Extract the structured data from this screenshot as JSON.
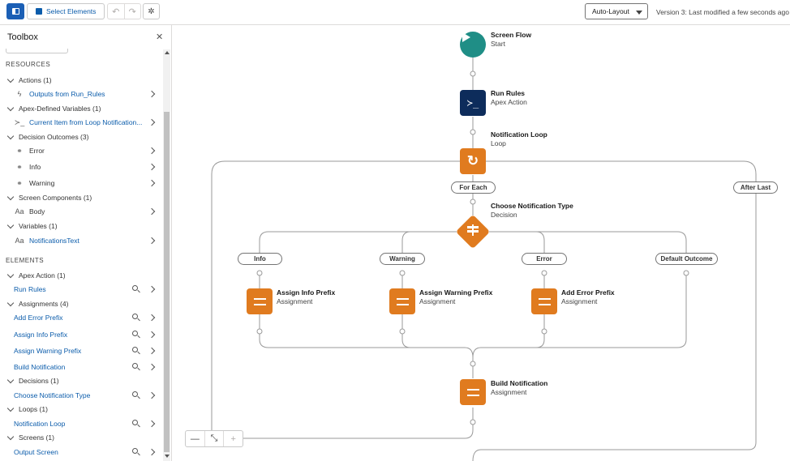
{
  "toolbar": {
    "select_elements": "Select Elements",
    "auto_layout": "Auto-Layout",
    "version_text": "Version 3: Last modified a few seconds ago"
  },
  "toolbox": {
    "title": "Toolbox",
    "resources_heading": "RESOURCES",
    "elements_heading": "ELEMENTS",
    "resources": [
      {
        "group": "Actions (1)",
        "items": [
          {
            "icon": "lightning-icon",
            "label": "Outputs from Run_Rules",
            "link": true
          }
        ]
      },
      {
        "group": "Apex-Defined Variables (1)",
        "items": [
          {
            "icon": "apex-icon",
            "label": "Current Item from Loop Notification...",
            "link": true
          }
        ]
      },
      {
        "group": "Decision Outcomes (3)",
        "items": [
          {
            "icon": "outcome-icon",
            "label": "Error",
            "link": false
          },
          {
            "icon": "outcome-icon",
            "label": "Info",
            "link": false
          },
          {
            "icon": "outcome-icon",
            "label": "Warning",
            "link": false
          }
        ]
      },
      {
        "group": "Screen Components (1)",
        "items": [
          {
            "icon": "text-icon",
            "label": "Body",
            "link": false
          }
        ]
      },
      {
        "group": "Variables (1)",
        "items": [
          {
            "icon": "text-icon",
            "label": "NotificationsText",
            "link": true
          }
        ]
      }
    ],
    "elements": [
      {
        "group": "Apex Action (1)",
        "items": [
          "Run Rules"
        ]
      },
      {
        "group": "Assignments (4)",
        "items": [
          "Add Error Prefix",
          "Assign Info Prefix",
          "Assign Warning Prefix",
          "Build Notification"
        ]
      },
      {
        "group": "Decisions (1)",
        "items": [
          "Choose Notification Type"
        ]
      },
      {
        "group": "Loops (1)",
        "items": [
          "Notification Loop"
        ]
      },
      {
        "group": "Screens (1)",
        "items": [
          "Output Screen"
        ]
      }
    ]
  },
  "canvas": {
    "start": {
      "title": "Screen Flow",
      "subtitle": "Start"
    },
    "run_rules": {
      "title": "Run Rules",
      "subtitle": "Apex Action"
    },
    "loop": {
      "title": "Notification Loop",
      "subtitle": "Loop",
      "for_each": "For Each",
      "after_last": "After Last"
    },
    "decision": {
      "title": "Choose Notification Type",
      "subtitle": "Decision"
    },
    "outcomes": [
      "Info",
      "Warning",
      "Error",
      "Default Outcome"
    ],
    "assign_info": {
      "title": "Assign Info Prefix",
      "subtitle": "Assignment"
    },
    "assign_warning": {
      "title": "Assign Warning Prefix",
      "subtitle": "Assignment"
    },
    "add_error": {
      "title": "Add Error Prefix",
      "subtitle": "Assignment"
    },
    "build_notification": {
      "title": "Build Notification",
      "subtitle": "Assignment"
    }
  },
  "colors": {
    "start": "#1f8e86",
    "apex": "#0d2c5b",
    "loop_assign": "#e07b1f",
    "brand": "#0b5cab"
  }
}
